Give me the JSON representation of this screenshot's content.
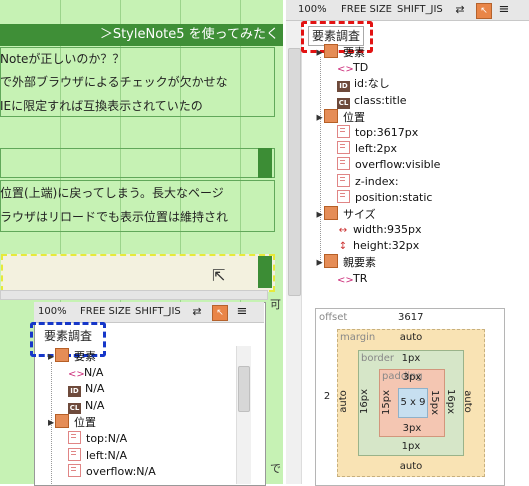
{
  "toolbar": {
    "zoom": "100%",
    "free_size": "FREE SIZE",
    "encoding": "SHIFT_JIS",
    "icons": [
      "refresh-icon",
      "cursor-select-icon",
      "menu-icon"
    ]
  },
  "editor": {
    "header": "＞StyleNote5 を使ってみたく",
    "lines": [
      "Noteが正しいのか？？",
      "で外部ブラウザによるチェックが欠かせな",
      "IEに限定すれば互換表示されていたの",
      "位置(上端)に戻ってしまう。長大なページ",
      "ラウザはリロードでも表示位置は維持され"
    ],
    "edge_chars": [
      "可",
      "で"
    ]
  },
  "inspector": {
    "title": "要素調査",
    "tree": [
      {
        "label": "要素",
        "kind": "group",
        "level": 0
      },
      {
        "label": "TD",
        "kind": "tag",
        "level": 1
      },
      {
        "label": "id:なし",
        "kind": "id",
        "level": 1
      },
      {
        "label": "class:title",
        "kind": "class",
        "level": 1
      },
      {
        "label": "位置",
        "kind": "group",
        "level": 0
      },
      {
        "label": "top:3617px",
        "kind": "prop",
        "level": 1
      },
      {
        "label": "left:2px",
        "kind": "prop",
        "level": 1
      },
      {
        "label": "overflow:visible",
        "kind": "prop",
        "level": 1
      },
      {
        "label": "z-index:",
        "kind": "prop",
        "level": 1
      },
      {
        "label": "position:static",
        "kind": "prop",
        "level": 1
      },
      {
        "label": "サイズ",
        "kind": "group",
        "level": 0
      },
      {
        "label": "width:935px",
        "kind": "hsize",
        "level": 1
      },
      {
        "label": "height:32px",
        "kind": "vsize",
        "level": 1
      },
      {
        "label": "親要素",
        "kind": "group",
        "level": 0
      },
      {
        "label": "TR",
        "kind": "tag",
        "level": 1
      }
    ],
    "box_model": {
      "offset_label": "offset",
      "offset_value": "3617",
      "offset_left": "2",
      "margin_label": "margin",
      "margin_top": "auto",
      "margin_bottom": "auto",
      "margin_left": "auto",
      "margin_right": "auto",
      "border_label": "border",
      "border_top": "1px",
      "border_bottom": "1px",
      "border_left": "16px",
      "border_right": "16px",
      "padding_label": "padding",
      "padding_top": "3px",
      "padding_bottom": "3px",
      "padding_left": "15px",
      "padding_right": "15px",
      "content": "5 x 9"
    }
  },
  "panel2": {
    "toolbar": {
      "zoom": "100%",
      "free_size": "FREE SIZE",
      "encoding": "SHIFT_JIS"
    },
    "title": "要素調査",
    "tree": [
      {
        "label": "要素",
        "kind": "group"
      },
      {
        "label": "N/A",
        "kind": "tag"
      },
      {
        "label": "N/A",
        "kind": "id"
      },
      {
        "label": "N/A",
        "kind": "class"
      },
      {
        "label": "位置",
        "kind": "group"
      },
      {
        "label": "top:N/A",
        "kind": "prop"
      },
      {
        "label": "left:N/A",
        "kind": "prop"
      },
      {
        "label": "overflow:N/A",
        "kind": "prop"
      }
    ]
  },
  "colors": {
    "editor_bg": "#c6f2b4",
    "editor_header": "#3f8f37",
    "highlight_red": "#e21313",
    "highlight_blue": "#1637c9",
    "highlight_yellow": "#e6ea3a",
    "margin_box": "#f9e3b4",
    "border_box": "#d6e6c8",
    "padding_box": "#f4c6b2",
    "content_box": "#c7dff0"
  }
}
